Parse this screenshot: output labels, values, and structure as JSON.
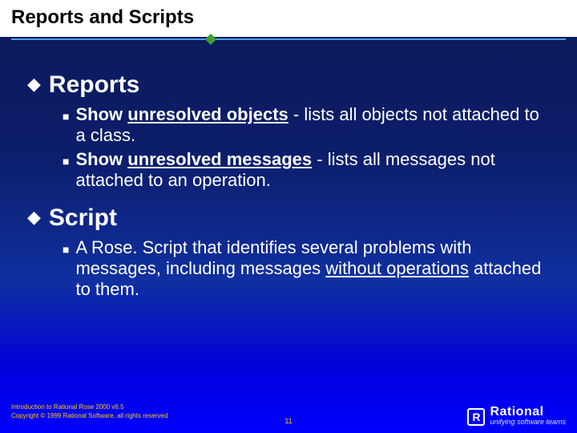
{
  "title": "Reports and Scripts",
  "sections": [
    {
      "heading": "Reports",
      "items": [
        {
          "lead_bold": "Show ",
          "lead_underline": "unresolved objects",
          "sep": "  - ",
          "rest": "lists all objects not attached to a class."
        },
        {
          "lead_bold": "Show ",
          "lead_underline": "unresolved messages",
          "sep": " -  ",
          "rest": "lists all messages not attached to an operation."
        }
      ]
    },
    {
      "heading": "Script",
      "items": [
        {
          "plain_pre": "A Rose. Script that identifies several problems with messages, including messages ",
          "underline": "without operations",
          "plain_post": " attached to them."
        }
      ]
    }
  ],
  "footer": {
    "line1": "Introduction to Rational Rose 2000 v6.5",
    "line2": "Copyright © 1999 Rational Software, all rights reserved",
    "page": "11",
    "logo_name": "Rational",
    "logo_tag": "unifying software teams",
    "logo_mark": "R"
  }
}
